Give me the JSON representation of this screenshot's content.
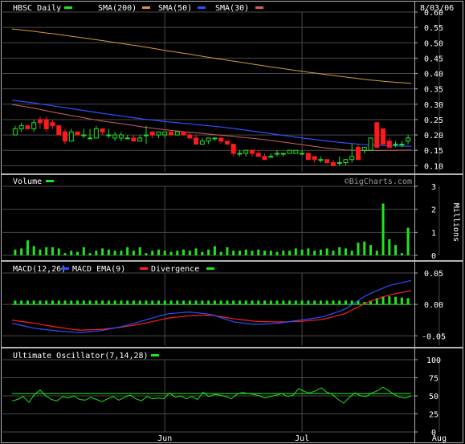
{
  "colors": {
    "background": "#000000",
    "frame": "#b4b4b4",
    "grid": "#4a4a4a",
    "text": "#ffffff",
    "up": "#1fe51f",
    "down": "#ff1a1a",
    "sma200": "#d49b3c",
    "sma50": "#2f4fff",
    "sma30": "#d06060",
    "macd": "#2f4fff",
    "macd_ema": "#ff2020",
    "histogram": "#1fe51f",
    "uo": "#1fe51f"
  },
  "header": {
    "symbol_label": "HBSC Daily",
    "date": "8/03/06",
    "legend": [
      {
        "label": "SMA(200)",
        "color": "#d49b3c"
      },
      {
        "label": "SMA(50)",
        "color": "#2f4fff"
      },
      {
        "label": "SMA(30)",
        "color": "#d06060"
      }
    ]
  },
  "volume_panel": {
    "title": "Volume",
    "watermark": "©BigCharts.com",
    "axis_label": "Millions"
  },
  "macd_panel": {
    "title": "MACD(12,26)",
    "legend": [
      {
        "label": "MACD EMA(9)",
        "color": "#2f4fff"
      },
      {
        "label": "Divergence",
        "color": "#ff2020"
      }
    ]
  },
  "uo_panel": {
    "title": "Ultimate Oscillator(7,14,28)"
  },
  "month_labels": [
    {
      "label": "Jun",
      "index": 24
    },
    {
      "label": "Jul",
      "index": 46
    },
    {
      "label": "Aug",
      "index": 68
    }
  ],
  "chart_data": [
    {
      "type": "candlestick",
      "title": "HBSC Daily",
      "ylim": [
        0.08,
        0.6
      ],
      "yticks": [
        "0.10",
        "0.15",
        "0.20",
        "0.25",
        "0.30",
        "0.35",
        "0.40",
        "0.45",
        "0.50",
        "0.55",
        "0.60"
      ],
      "grid": true,
      "candles": [
        [
          0.2,
          0.23,
          0.2,
          0.22
        ],
        [
          0.22,
          0.24,
          0.21,
          0.23
        ],
        [
          0.23,
          0.23,
          0.22,
          0.22
        ],
        [
          0.22,
          0.25,
          0.21,
          0.24
        ],
        [
          0.25,
          0.26,
          0.22,
          0.24
        ],
        [
          0.25,
          0.26,
          0.21,
          0.22
        ],
        [
          0.24,
          0.25,
          0.22,
          0.23
        ],
        [
          0.23,
          0.23,
          0.2,
          0.2
        ],
        [
          0.21,
          0.22,
          0.17,
          0.18
        ],
        [
          0.18,
          0.22,
          0.18,
          0.21
        ],
        [
          0.21,
          0.21,
          0.2,
          0.2
        ],
        [
          0.2,
          0.22,
          0.19,
          0.2
        ],
        [
          0.19,
          0.22,
          0.19,
          0.19
        ],
        [
          0.19,
          0.23,
          0.19,
          0.22
        ],
        [
          0.22,
          0.22,
          0.2,
          0.21
        ],
        [
          0.2,
          0.22,
          0.19,
          0.2
        ],
        [
          0.19,
          0.21,
          0.18,
          0.2
        ],
        [
          0.19,
          0.21,
          0.18,
          0.2
        ],
        [
          0.19,
          0.2,
          0.19,
          0.19
        ],
        [
          0.19,
          0.2,
          0.18,
          0.18
        ],
        [
          0.18,
          0.2,
          0.18,
          0.19
        ],
        [
          0.2,
          0.23,
          0.17,
          0.2
        ],
        [
          0.21,
          0.21,
          0.19,
          0.2
        ],
        [
          0.2,
          0.21,
          0.19,
          0.21
        ],
        [
          0.2,
          0.21,
          0.19,
          0.21
        ],
        [
          0.21,
          0.21,
          0.2,
          0.2
        ],
        [
          0.2,
          0.21,
          0.2,
          0.21
        ],
        [
          0.21,
          0.21,
          0.2,
          0.2
        ],
        [
          0.2,
          0.21,
          0.19,
          0.19
        ],
        [
          0.19,
          0.2,
          0.17,
          0.17
        ],
        [
          0.17,
          0.19,
          0.17,
          0.18
        ],
        [
          0.18,
          0.19,
          0.17,
          0.19
        ],
        [
          0.19,
          0.19,
          0.18,
          0.19
        ],
        [
          0.19,
          0.19,
          0.17,
          0.18
        ],
        [
          0.18,
          0.17,
          0.18,
          0.17
        ],
        [
          0.17,
          0.17,
          0.13,
          0.14
        ],
        [
          0.14,
          0.15,
          0.13,
          0.14
        ],
        [
          0.14,
          0.15,
          0.13,
          0.15
        ],
        [
          0.15,
          0.15,
          0.13,
          0.14
        ],
        [
          0.14,
          0.15,
          0.13,
          0.13
        ],
        [
          0.13,
          0.14,
          0.12,
          0.12
        ],
        [
          0.13,
          0.14,
          0.13,
          0.13
        ],
        [
          0.14,
          0.15,
          0.13,
          0.14
        ],
        [
          0.14,
          0.14,
          0.13,
          0.14
        ],
        [
          0.14,
          0.15,
          0.14,
          0.15
        ],
        [
          0.14,
          0.15,
          0.14,
          0.15
        ],
        [
          0.14,
          0.15,
          0.14,
          0.14
        ],
        [
          0.14,
          0.14,
          0.12,
          0.12
        ],
        [
          0.13,
          0.13,
          0.11,
          0.12
        ],
        [
          0.12,
          0.13,
          0.11,
          0.12
        ],
        [
          0.12,
          0.12,
          0.11,
          0.11
        ],
        [
          0.11,
          0.12,
          0.1,
          0.1
        ],
        [
          0.11,
          0.13,
          0.1,
          0.11
        ],
        [
          0.11,
          0.12,
          0.1,
          0.12
        ],
        [
          0.12,
          0.17,
          0.11,
          0.13
        ],
        [
          0.16,
          0.17,
          0.12,
          0.12
        ],
        [
          0.15,
          0.16,
          0.14,
          0.16
        ],
        [
          0.15,
          0.19,
          0.15,
          0.19
        ],
        [
          0.24,
          0.24,
          0.16,
          0.16
        ],
        [
          0.22,
          0.22,
          0.17,
          0.17
        ],
        [
          0.18,
          0.19,
          0.16,
          0.16
        ],
        [
          0.17,
          0.18,
          0.16,
          0.17
        ],
        [
          0.17,
          0.18,
          0.16,
          0.17
        ],
        [
          0.18,
          0.2,
          0.17,
          0.19
        ]
      ],
      "sma200": [
        0.545,
        0.537,
        0.528,
        0.518,
        0.508,
        0.497,
        0.486,
        0.474,
        0.463,
        0.451,
        0.44,
        0.429,
        0.418,
        0.408,
        0.398,
        0.389,
        0.38,
        0.373,
        0.368
      ],
      "sma50": [
        0.313,
        0.304,
        0.293,
        0.282,
        0.271,
        0.261,
        0.251,
        0.243,
        0.236,
        0.229,
        0.221,
        0.211,
        0.201,
        0.191,
        0.182,
        0.174,
        0.168,
        0.165,
        0.163
      ],
      "sma30": [
        0.299,
        0.287,
        0.272,
        0.259,
        0.246,
        0.236,
        0.225,
        0.216,
        0.209,
        0.202,
        0.195,
        0.188,
        0.179,
        0.169,
        0.159,
        0.151,
        0.149,
        0.15,
        0.151
      ]
    },
    {
      "type": "bar",
      "title": "Volume",
      "ylabel": "Millions",
      "ylim": [
        0,
        3
      ],
      "yticks": [
        "0",
        "1",
        "2",
        "3"
      ],
      "values": [
        0.25,
        0.3,
        0.65,
        0.4,
        0.25,
        0.35,
        0.35,
        0.3,
        0.1,
        0.2,
        0.15,
        0.35,
        0.1,
        0.2,
        0.3,
        0.25,
        0.2,
        0.2,
        0.35,
        0.2,
        0.35,
        0.1,
        0.2,
        0.25,
        0.2,
        0.15,
        0.2,
        0.25,
        0.2,
        0.3,
        0.15,
        0.25,
        0.4,
        0.15,
        0.35,
        0.2,
        0.2,
        0.25,
        0.2,
        0.25,
        0.2,
        0.2,
        0.15,
        0.2,
        0.2,
        0.3,
        0.25,
        0.3,
        0.2,
        0.25,
        0.3,
        0.2,
        0.35,
        0.3,
        0.2,
        0.55,
        0.6,
        0.45,
        0.2,
        2.25,
        0.7,
        0.45,
        0.1,
        1.2
      ]
    },
    {
      "type": "line",
      "title": "MACD(12,26)",
      "ylim": [
        -0.065,
        0.05
      ],
      "yticks": [
        "0.05",
        "0.00",
        "-0.05"
      ],
      "series": [
        {
          "name": "MACD EMA(9)",
          "values": [
            -0.03,
            -0.038,
            -0.042,
            -0.045,
            -0.042,
            -0.035,
            -0.025,
            -0.015,
            -0.012,
            -0.016,
            -0.028,
            -0.032,
            -0.03,
            -0.025,
            -0.02,
            -0.008,
            0.015,
            0.03,
            0.038
          ]
        },
        {
          "name": "Divergence",
          "values": [
            -0.025,
            -0.03,
            -0.036,
            -0.041,
            -0.04,
            -0.036,
            -0.03,
            -0.022,
            -0.018,
            -0.017,
            -0.023,
            -0.027,
            -0.028,
            -0.027,
            -0.024,
            -0.015,
            0.003,
            0.015,
            0.022
          ]
        }
      ],
      "histogram": [
        0.006,
        0.006,
        0.006,
        0.006,
        0.006,
        0.006,
        0.006,
        0.006,
        0.006,
        0.006,
        0.006,
        0.006,
        0.006,
        0.006,
        0.006,
        0.006,
        0.006,
        0.006,
        0.006,
        0.006,
        0.006,
        0.006,
        0.006,
        0.006,
        0.006,
        0.006,
        0.006,
        0.006,
        0.006,
        0.006,
        0.006,
        0.006,
        0.006,
        0.006,
        0.006,
        0.006,
        0.006,
        0.006,
        0.006,
        0.006,
        0.006,
        0.006,
        0.006,
        0.006,
        0.006,
        0.006,
        0.006,
        0.006,
        0.006,
        0.006,
        0.006,
        0.006,
        0.006,
        0.006,
        0.006,
        0.006,
        0.004,
        0.006,
        0.01,
        0.013,
        0.013,
        0.012,
        0.011,
        0.01
      ]
    },
    {
      "type": "line",
      "title": "Ultimate Oscillator(7,14,28)",
      "ylim": [
        0,
        100
      ],
      "yticks": [
        "100",
        "75",
        "50",
        "25",
        "0"
      ],
      "reference": 53,
      "values": [
        43,
        45,
        49,
        41,
        52,
        58,
        50,
        45,
        43,
        49,
        47,
        50,
        45,
        44,
        48,
        45,
        42,
        46,
        49,
        44,
        48,
        51,
        46,
        43,
        49,
        46,
        47,
        46,
        54,
        48,
        50,
        46,
        49,
        45,
        55,
        49,
        52,
        51,
        49,
        46,
        52,
        55,
        53,
        52,
        50,
        47,
        49,
        51,
        53,
        49,
        51,
        60,
        56,
        54,
        57,
        61,
        55,
        52,
        45,
        40,
        48,
        54,
        50,
        49,
        54,
        57,
        62,
        57,
        52,
        48,
        47,
        50
      ]
    }
  ]
}
